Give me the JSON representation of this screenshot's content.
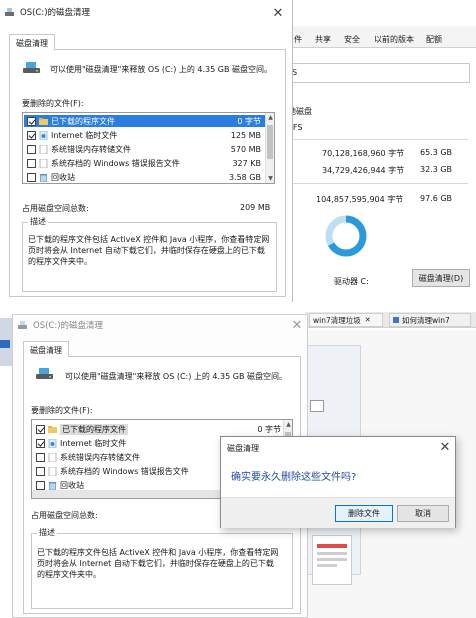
{
  "top": {
    "window_title": "OS(C:)的磁盘清理",
    "tab_label": "磁盘清理",
    "info_text": "可以使用\"磁盘清理\"来释放 OS (C:) 上的 4.35 GB 磁盘空间。",
    "files_label": "要删除的文件(F):",
    "files": [
      {
        "name": "已下载的程序文件",
        "size": "0 字节",
        "checked": true,
        "selected": true
      },
      {
        "name": "Internet 临时文件",
        "size": "125 MB",
        "checked": true,
        "selected": false
      },
      {
        "name": "系统错误内存转储文件",
        "size": "570 MB",
        "checked": false,
        "selected": false
      },
      {
        "name": "系统存档的 Windows 错误报告文件",
        "size": "327 KB",
        "checked": false,
        "selected": false
      },
      {
        "name": "回收站",
        "size": "3.58 GB",
        "checked": false,
        "selected": false
      }
    ],
    "total_label": "占用磁盘空间总数:",
    "total_value": "209 MB",
    "desc_title": "描述",
    "desc_text": [
      "已下载的程序文件包括 ActiveX 控件和 Java 小程序，你查看特定网",
      "页时将会从 Internet 自动下载它们，并临时保存在硬盘上的已下载",
      "的程序文件夹中。"
    ]
  },
  "props_bg": {
    "tabs": [
      "件",
      "共享",
      "安全",
      "以前的版本",
      "配额"
    ],
    "fs_short": "S",
    "disk_label": "地磁盘",
    "fs_label": "TFS",
    "used_bytes": "70,128,168,960 字节",
    "used_gb": "65.3 GB",
    "free_bytes": "34,729,426,944 字节",
    "free_gb": "32.3 GB",
    "cap_bytes": "104,857,595,904 字节",
    "cap_gb": "97.6 GB",
    "drive_label": "驱动器 C:",
    "cleanup_btn": "磁盘清理(D)"
  },
  "bottom": {
    "window_title": "OS(C:)的磁盘清理",
    "tab_label": "磁盘清理",
    "info_text": "可以使用\"磁盘清理\"来释放 OS (C:) 上的 4.35 GB 磁盘空间。",
    "files_label": "要删除的文件(F):",
    "files": [
      {
        "name": "已下载的程序文件",
        "size": "0 字节",
        "checked": true
      },
      {
        "name": "Internet 临时文件",
        "size": "",
        "checked": true
      },
      {
        "name": "系统错误内存转储文件",
        "size": "",
        "checked": false
      },
      {
        "name": "系统存档的 Windows 错误报告文件",
        "size": "",
        "checked": false
      },
      {
        "name": "回收站",
        "size": "",
        "checked": false
      }
    ],
    "total_label": "占用磁盘空间总数:",
    "desc_title": "描述",
    "desc_text": [
      "已下载的程序文件包括 ActiveX 控件和 Java 小程序，你查看特定网",
      "页时将会从 Internet 自动下载它们，并临时保存在硬盘上的已下载",
      "的程序文件夹中。"
    ],
    "browser_tab1": "win7清理垃圾",
    "browser_tab2": "如何清理win7"
  },
  "confirm": {
    "title": "磁盘清理",
    "message": "确实要永久删除这些文件吗?",
    "delete_btn": "删除文件",
    "cancel_btn": "取消"
  },
  "colors": {
    "selection": "#2a7de1",
    "link_blue": "#1f4e9a",
    "donut_blue": "#2c9ad8",
    "donut_light": "#bcdff3"
  }
}
